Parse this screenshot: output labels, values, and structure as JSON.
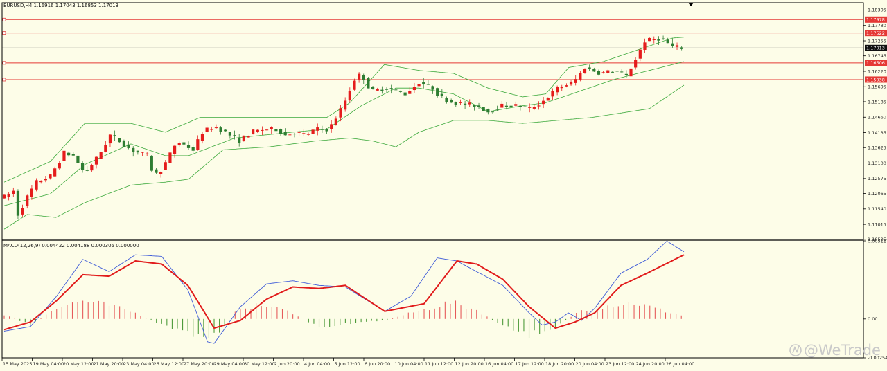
{
  "header": {
    "symbol_text": "EURUSD,H4  1.16916 1.17043 1.16853 1.17013",
    "macd_text": "MACD(12,26,9) 0.004422 0.004188 0.000305 0.000000"
  },
  "watermark": {
    "text": "@WeTrade"
  },
  "colors": {
    "background": "#fdfde8",
    "bull_candle": "#e51c1c",
    "bear_candle": "#2e7d32",
    "bollinger": "#3aa83a",
    "level_line": "#e53935",
    "macd_line": "#3e5bd8",
    "signal_line": "#e11b1b",
    "hist_positive": "#e65a5a",
    "hist_negative": "#4d9a3a"
  },
  "chart_data": [
    {
      "type": "candlestick",
      "symbol": "EURUSD",
      "timeframe": "H4",
      "ylim": [
        1.105,
        1.1855
      ],
      "y_ticks": [
        "1.18305",
        "1.17780",
        "1.17255",
        "1.16745",
        "1.16220",
        "1.15695",
        "1.15185",
        "1.14660",
        "1.14135",
        "1.13625",
        "1.13100",
        "1.12575",
        "1.12065",
        "1.11540",
        "1.11015",
        "1.10505"
      ],
      "x_tick_labels": [
        "15 May 2025",
        "19 May 04:00",
        "20 May 12:00",
        "21 May 20:00",
        "23 May 04:00",
        "26 May 12:00",
        "27 May 20:00",
        "29 May 04:00",
        "30 May 12:00",
        "2 Jun 20:00",
        "4 Jun 04:00",
        "5 Jun 12:00",
        "6 Jun 20:00",
        "10 Jun 04:00",
        "11 Jun 12:00",
        "12 Jun 20:00",
        "16 Jun 04:00",
        "17 Jun 12:00",
        "18 Jun 20:00",
        "20 Jun 04:00",
        "23 Jun 12:00",
        "24 Jun 20:00",
        "26 Jun 04:00"
      ],
      "current_price": "1.17013",
      "horizontal_levels": [
        {
          "value": 1.17978,
          "label": "1.17978"
        },
        {
          "value": 1.17522,
          "label": "1.17522"
        },
        {
          "value": 1.16506,
          "label": "1.16506"
        },
        {
          "value": 1.15938,
          "label": "1.15938"
        }
      ],
      "close_anchors": [
        [
          0,
          1.1195
        ],
        [
          8,
          1.1215
        ],
        [
          12,
          1.1135
        ],
        [
          20,
          1.1195
        ],
        [
          28,
          1.1245
        ],
        [
          40,
          1.1265
        ],
        [
          52,
          1.1345
        ],
        [
          60,
          1.1335
        ],
        [
          70,
          1.1275
        ],
        [
          82,
          1.1335
        ],
        [
          92,
          1.1405
        ],
        [
          100,
          1.1385
        ],
        [
          110,
          1.1355
        ],
        [
          124,
          1.1335
        ],
        [
          130,
          1.1265
        ],
        [
          138,
          1.1295
        ],
        [
          150,
          1.1385
        ],
        [
          164,
          1.1355
        ],
        [
          172,
          1.1415
        ],
        [
          182,
          1.1435
        ],
        [
          192,
          1.1415
        ],
        [
          204,
          1.1385
        ],
        [
          214,
          1.1415
        ],
        [
          226,
          1.1425
        ],
        [
          236,
          1.1425
        ],
        [
          244,
          1.1405
        ],
        [
          252,
          1.1415
        ],
        [
          262,
          1.1405
        ],
        [
          270,
          1.1425
        ],
        [
          282,
          1.1425
        ],
        [
          294,
          1.1505
        ],
        [
          304,
          1.1595
        ],
        [
          310,
          1.1615
        ],
        [
          318,
          1.1555
        ],
        [
          332,
          1.1565
        ],
        [
          348,
          1.1545
        ],
        [
          360,
          1.1585
        ],
        [
          372,
          1.1565
        ],
        [
          378,
          1.1535
        ],
        [
          390,
          1.1515
        ],
        [
          410,
          1.1505
        ],
        [
          420,
          1.1485
        ],
        [
          432,
          1.1505
        ],
        [
          446,
          1.1505
        ],
        [
          456,
          1.1495
        ],
        [
          466,
          1.1515
        ],
        [
          480,
          1.1565
        ],
        [
          494,
          1.1585
        ],
        [
          504,
          1.1635
        ],
        [
          518,
          1.1615
        ],
        [
          530,
          1.1625
        ],
        [
          540,
          1.1605
        ],
        [
          556,
          1.1725
        ],
        [
          570,
          1.1735
        ],
        [
          580,
          1.1705
        ],
        [
          590,
          1.1701
        ]
      ],
      "bollinger_anchors": {
        "upper": [
          [
            0,
            1.1245
          ],
          [
            40,
            1.1315
          ],
          [
            70,
            1.1445
          ],
          [
            110,
            1.1445
          ],
          [
            140,
            1.1415
          ],
          [
            170,
            1.1465
          ],
          [
            230,
            1.1465
          ],
          [
            280,
            1.1465
          ],
          [
            300,
            1.1515
          ],
          [
            330,
            1.1645
          ],
          [
            360,
            1.1625
          ],
          [
            390,
            1.1615
          ],
          [
            420,
            1.1565
          ],
          [
            450,
            1.1535
          ],
          [
            470,
            1.1545
          ],
          [
            490,
            1.1635
          ],
          [
            520,
            1.1655
          ],
          [
            550,
            1.1695
          ],
          [
            580,
            1.1735
          ],
          [
            590,
            1.1738
          ]
        ],
        "middle": [
          [
            0,
            1.1165
          ],
          [
            40,
            1.1205
          ],
          [
            70,
            1.1305
          ],
          [
            110,
            1.1375
          ],
          [
            140,
            1.1335
          ],
          [
            160,
            1.1335
          ],
          [
            200,
            1.1395
          ],
          [
            250,
            1.1415
          ],
          [
            280,
            1.1425
          ],
          [
            310,
            1.1505
          ],
          [
            340,
            1.1565
          ],
          [
            360,
            1.1565
          ],
          [
            390,
            1.1545
          ],
          [
            420,
            1.1485
          ],
          [
            450,
            1.1505
          ],
          [
            470,
            1.1515
          ],
          [
            500,
            1.1555
          ],
          [
            530,
            1.1595
          ],
          [
            560,
            1.1625
          ],
          [
            590,
            1.1655
          ]
        ],
        "lower": [
          [
            0,
            1.1085
          ],
          [
            20,
            1.1135
          ],
          [
            45,
            1.1125
          ],
          [
            70,
            1.1175
          ],
          [
            110,
            1.1235
          ],
          [
            140,
            1.1245
          ],
          [
            160,
            1.1255
          ],
          [
            190,
            1.1355
          ],
          [
            230,
            1.1365
          ],
          [
            270,
            1.1385
          ],
          [
            300,
            1.1395
          ],
          [
            320,
            1.1385
          ],
          [
            340,
            1.1365
          ],
          [
            360,
            1.1415
          ],
          [
            390,
            1.1455
          ],
          [
            420,
            1.1455
          ],
          [
            450,
            1.1445
          ],
          [
            480,
            1.1455
          ],
          [
            510,
            1.1465
          ],
          [
            560,
            1.1495
          ],
          [
            590,
            1.1575
          ]
        ]
      }
    },
    {
      "type": "macd",
      "params": "12,26,9",
      "values": {
        "macd": 0.004422,
        "signal": 0.004188,
        "histogram": 0.000305
      },
      "ylim": [
        -0.002548,
        0.005117
      ],
      "y_ticks": [
        "0.005117",
        "0.00",
        "-0.002548"
      ],
      "macd_anchors": [
        [
          0,
          -0.0008
        ],
        [
          20,
          -0.0005
        ],
        [
          40,
          0.0015
        ],
        [
          60,
          0.0039
        ],
        [
          80,
          0.0031
        ],
        [
          100,
          0.0042
        ],
        [
          120,
          0.0041
        ],
        [
          140,
          0.0019
        ],
        [
          155,
          -0.0015
        ],
        [
          160,
          -0.0016
        ],
        [
          180,
          0.0008
        ],
        [
          200,
          0.0023
        ],
        [
          220,
          0.0025
        ],
        [
          240,
          0.0022
        ],
        [
          260,
          0.0021
        ],
        [
          290,
          0.0005
        ],
        [
          310,
          0.0015
        ],
        [
          330,
          0.004
        ],
        [
          345,
          0.0038
        ],
        [
          360,
          0.0031
        ],
        [
          380,
          0.0022
        ],
        [
          400,
          0.0004
        ],
        [
          410,
          -0.0004
        ],
        [
          420,
          -0.0002
        ],
        [
          430,
          0.0004
        ],
        [
          440,
          -0.0001
        ],
        [
          450,
          0.0007
        ],
        [
          470,
          0.003
        ],
        [
          490,
          0.0039
        ],
        [
          505,
          0.0051
        ],
        [
          518,
          0.0044
        ]
      ],
      "signal_anchors": [
        [
          0,
          -0.0007
        ],
        [
          20,
          -0.0002
        ],
        [
          40,
          0.0012
        ],
        [
          60,
          0.0029
        ],
        [
          80,
          0.0028
        ],
        [
          100,
          0.0038
        ],
        [
          120,
          0.0036
        ],
        [
          140,
          0.0022
        ],
        [
          160,
          -0.0006
        ],
        [
          180,
          -0.0001
        ],
        [
          200,
          0.0013
        ],
        [
          220,
          0.0021
        ],
        [
          240,
          0.002
        ],
        [
          260,
          0.0022
        ],
        [
          290,
          0.0005
        ],
        [
          320,
          0.001
        ],
        [
          345,
          0.0038
        ],
        [
          360,
          0.0036
        ],
        [
          380,
          0.0026
        ],
        [
          400,
          0.0008
        ],
        [
          420,
          -0.0006
        ],
        [
          435,
          -0.0002
        ],
        [
          450,
          0.0004
        ],
        [
          470,
          0.0022
        ],
        [
          490,
          0.003
        ],
        [
          518,
          0.0042
        ]
      ],
      "hist_anchors": [
        [
          0,
          0.0003
        ],
        [
          20,
          -0.0004
        ],
        [
          40,
          0.0008
        ],
        [
          60,
          0.0012
        ],
        [
          80,
          0.0009
        ],
        [
          100,
          0.0004
        ],
        [
          120,
          -0.0004
        ],
        [
          145,
          -0.0011
        ],
        [
          160,
          -0.0012
        ],
        [
          180,
          0.0008
        ],
        [
          200,
          0.0009
        ],
        [
          220,
          0.0004
        ],
        [
          240,
          -0.0006
        ],
        [
          270,
          -0.0002
        ],
        [
          290,
          -0.0001
        ],
        [
          310,
          0.0004
        ],
        [
          340,
          0.0011
        ],
        [
          360,
          0.0006
        ],
        [
          380,
          -0.0005
        ],
        [
          400,
          -0.0011
        ],
        [
          420,
          -0.0005
        ],
        [
          440,
          0.0006
        ],
        [
          460,
          0.0009
        ],
        [
          480,
          0.0011
        ],
        [
          500,
          0.0006
        ],
        [
          518,
          0.0002
        ]
      ]
    }
  ]
}
